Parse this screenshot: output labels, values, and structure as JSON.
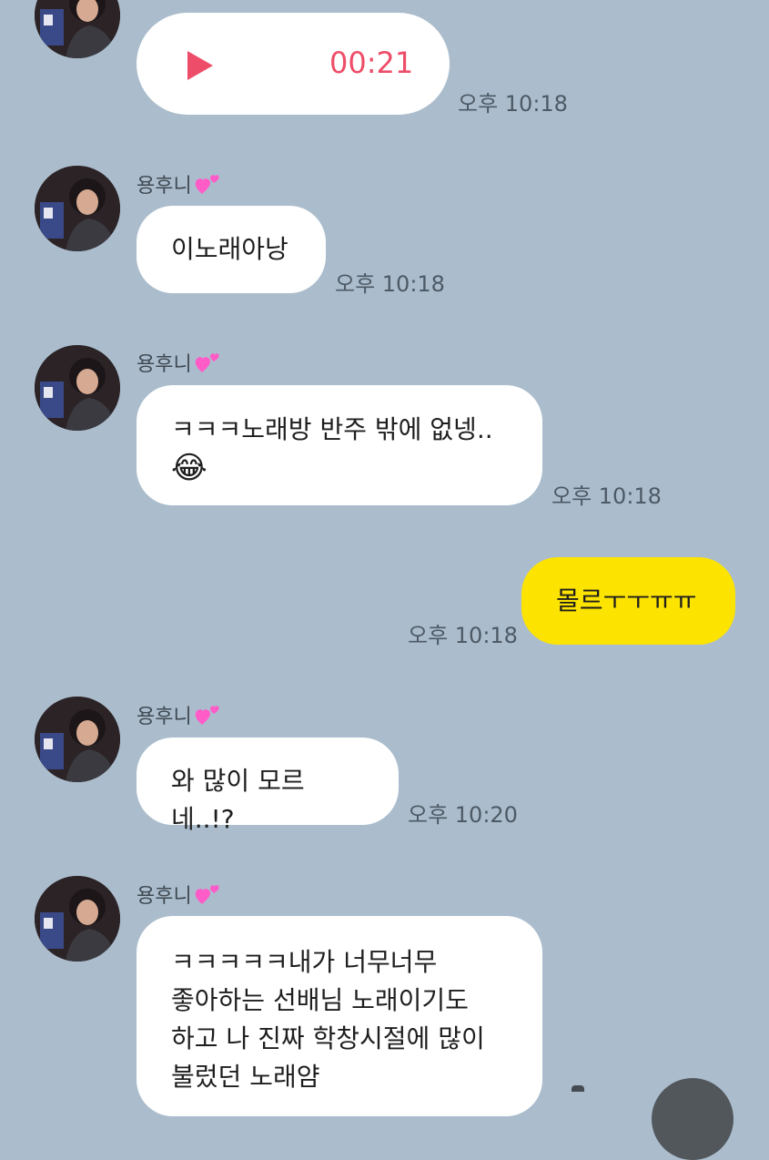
{
  "messages": [
    {
      "sender": "용후니",
      "type": "audio",
      "duration": "00:21",
      "time": "오후 10:18"
    },
    {
      "sender": "용후니",
      "type": "text",
      "text": "이노래아낭",
      "time": "오후 10:18"
    },
    {
      "sender": "용후니",
      "type": "text",
      "lines": [
        "ㅋㅋㅋ노래방 반주 밖에 없넹..",
        "😂"
      ],
      "time": "오후 10:18"
    },
    {
      "sender": "me",
      "type": "text",
      "text": "몰르ㅜㅜㅠㅠ",
      "time": "오후 10:18"
    },
    {
      "sender": "용후니",
      "type": "text",
      "text": "와 많이 모르네..!?",
      "time": "오후 10:20"
    },
    {
      "sender": "용후니",
      "type": "text",
      "lines": [
        "ㅋㅋㅋㅋㅋ내가 너무너무",
        "좋아하는 선배님 노래이기도",
        "하고 나 진짜 학창시절에 많이",
        "불렀던 노래얌"
      ]
    }
  ],
  "icons": {
    "name_heart": "two-hearts-icon",
    "play": "play-icon",
    "avatar": "avatar-photo"
  },
  "colors": {
    "background": "#abbdcd",
    "my_bubble": "#fde300",
    "their_bubble": "#ffffff",
    "audio_accent": "#ed4d68"
  }
}
